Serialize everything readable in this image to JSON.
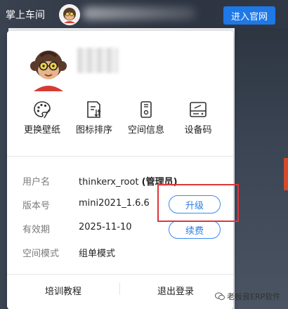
{
  "header": {
    "app_title": "掌上车间",
    "enter_button": "进入官网"
  },
  "actions": [
    {
      "label": "更换壁纸",
      "icon": "palette-icon"
    },
    {
      "label": "图标排序",
      "icon": "sort-icon"
    },
    {
      "label": "空间信息",
      "icon": "storage-info-icon"
    },
    {
      "label": "设备码",
      "icon": "device-code-icon"
    }
  ],
  "info": {
    "username_label": "用户名",
    "username_value": "thinkerx_root",
    "role": "(管理员)",
    "version_label": "版本号",
    "version_value": "mini2021_1.6.6",
    "upgrade_button": "升级",
    "validity_label": "有效期",
    "validity_value": "2025-11-10",
    "renew_button": "续费",
    "space_mode_label": "空间模式",
    "space_mode_value": "组单模式"
  },
  "footer": {
    "training": "培训教程",
    "logout": "退出登录"
  },
  "watermark": "老板良ERP软件",
  "colors": {
    "accent": "#1e78e6",
    "highlight": "#e0353a",
    "topbar": "#2c3340"
  }
}
